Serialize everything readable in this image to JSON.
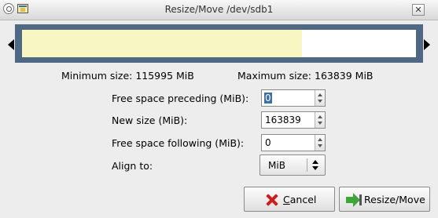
{
  "window": {
    "title": "Resize/Move /dev/sdb1",
    "close_glyph": "✕"
  },
  "partition_graph": {
    "used_fraction": 0.71,
    "frame_color": "#4f6884",
    "used_color": "#f8f7c4"
  },
  "sizes": {
    "minimum": "Minimum size: 115995 MiB",
    "maximum": "Maximum size: 163839 MiB"
  },
  "fields": {
    "preceding": {
      "label": "Free space preceding (MiB):",
      "value": "0"
    },
    "new_size": {
      "label": "New size (MiB):",
      "value": "163839"
    },
    "following": {
      "label": "Free space following (MiB):",
      "value": "0"
    },
    "align": {
      "label": "Align to:",
      "value": "MiB"
    }
  },
  "buttons": {
    "cancel_prefix": "C",
    "cancel_rest": "ancel",
    "resize": "Resize/Move"
  }
}
